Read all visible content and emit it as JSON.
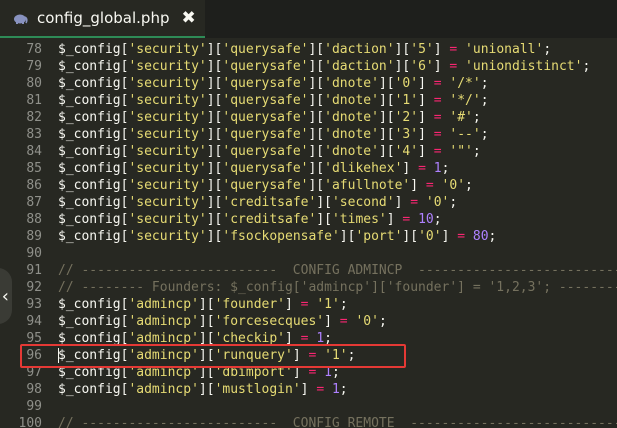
{
  "tab": {
    "title": "config_global.php",
    "close_glyph": "✖",
    "icon": "php-elephant-icon"
  },
  "side_button": {
    "glyph": "‹"
  },
  "colors": {
    "background": "#272822",
    "string": "#e6db74",
    "operator": "#f92672",
    "number": "#ae81ff",
    "comment": "#75715e",
    "line_number": "#8f908a",
    "highlight_box": "#e53935"
  },
  "highlighted_line": 96,
  "lines": [
    {
      "num": "78",
      "tokens": [
        [
          "v",
          "$_config"
        ],
        [
          "p",
          "["
        ],
        [
          "s",
          "'security'"
        ],
        [
          "p",
          "]["
        ],
        [
          "s",
          "'querysafe'"
        ],
        [
          "p",
          "]["
        ],
        [
          "s",
          "'daction'"
        ],
        [
          "p",
          "]["
        ],
        [
          "s",
          "'5'"
        ],
        [
          "p",
          "] "
        ],
        [
          "o",
          "="
        ],
        [
          "p",
          " "
        ],
        [
          "s",
          "'unionall'"
        ],
        [
          "p",
          ";"
        ]
      ]
    },
    {
      "num": "79",
      "tokens": [
        [
          "v",
          "$_config"
        ],
        [
          "p",
          "["
        ],
        [
          "s",
          "'security'"
        ],
        [
          "p",
          "]["
        ],
        [
          "s",
          "'querysafe'"
        ],
        [
          "p",
          "]["
        ],
        [
          "s",
          "'daction'"
        ],
        [
          "p",
          "]["
        ],
        [
          "s",
          "'6'"
        ],
        [
          "p",
          "] "
        ],
        [
          "o",
          "="
        ],
        [
          "p",
          " "
        ],
        [
          "s",
          "'uniondistinct'"
        ],
        [
          "p",
          ";"
        ]
      ]
    },
    {
      "num": "80",
      "tokens": [
        [
          "v",
          "$_config"
        ],
        [
          "p",
          "["
        ],
        [
          "s",
          "'security'"
        ],
        [
          "p",
          "]["
        ],
        [
          "s",
          "'querysafe'"
        ],
        [
          "p",
          "]["
        ],
        [
          "s",
          "'dnote'"
        ],
        [
          "p",
          "]["
        ],
        [
          "s",
          "'0'"
        ],
        [
          "p",
          "] "
        ],
        [
          "o",
          "="
        ],
        [
          "p",
          " "
        ],
        [
          "s",
          "'/*'"
        ],
        [
          "p",
          ";"
        ]
      ]
    },
    {
      "num": "81",
      "tokens": [
        [
          "v",
          "$_config"
        ],
        [
          "p",
          "["
        ],
        [
          "s",
          "'security'"
        ],
        [
          "p",
          "]["
        ],
        [
          "s",
          "'querysafe'"
        ],
        [
          "p",
          "]["
        ],
        [
          "s",
          "'dnote'"
        ],
        [
          "p",
          "]["
        ],
        [
          "s",
          "'1'"
        ],
        [
          "p",
          "] "
        ],
        [
          "o",
          "="
        ],
        [
          "p",
          " "
        ],
        [
          "s",
          "'*/'"
        ],
        [
          "p",
          ";"
        ]
      ]
    },
    {
      "num": "82",
      "tokens": [
        [
          "v",
          "$_config"
        ],
        [
          "p",
          "["
        ],
        [
          "s",
          "'security'"
        ],
        [
          "p",
          "]["
        ],
        [
          "s",
          "'querysafe'"
        ],
        [
          "p",
          "]["
        ],
        [
          "s",
          "'dnote'"
        ],
        [
          "p",
          "]["
        ],
        [
          "s",
          "'2'"
        ],
        [
          "p",
          "] "
        ],
        [
          "o",
          "="
        ],
        [
          "p",
          " "
        ],
        [
          "s",
          "'#'"
        ],
        [
          "p",
          ";"
        ]
      ]
    },
    {
      "num": "83",
      "tokens": [
        [
          "v",
          "$_config"
        ],
        [
          "p",
          "["
        ],
        [
          "s",
          "'security'"
        ],
        [
          "p",
          "]["
        ],
        [
          "s",
          "'querysafe'"
        ],
        [
          "p",
          "]["
        ],
        [
          "s",
          "'dnote'"
        ],
        [
          "p",
          "]["
        ],
        [
          "s",
          "'3'"
        ],
        [
          "p",
          "] "
        ],
        [
          "o",
          "="
        ],
        [
          "p",
          " "
        ],
        [
          "s",
          "'--'"
        ],
        [
          "p",
          ";"
        ]
      ]
    },
    {
      "num": "84",
      "tokens": [
        [
          "v",
          "$_config"
        ],
        [
          "p",
          "["
        ],
        [
          "s",
          "'security'"
        ],
        [
          "p",
          "]["
        ],
        [
          "s",
          "'querysafe'"
        ],
        [
          "p",
          "]["
        ],
        [
          "s",
          "'dnote'"
        ],
        [
          "p",
          "]["
        ],
        [
          "s",
          "'4'"
        ],
        [
          "p",
          "] "
        ],
        [
          "o",
          "="
        ],
        [
          "p",
          " "
        ],
        [
          "s",
          "'\"'"
        ],
        [
          "p",
          ";"
        ]
      ]
    },
    {
      "num": "85",
      "tokens": [
        [
          "v",
          "$_config"
        ],
        [
          "p",
          "["
        ],
        [
          "s",
          "'security'"
        ],
        [
          "p",
          "]["
        ],
        [
          "s",
          "'querysafe'"
        ],
        [
          "p",
          "]["
        ],
        [
          "s",
          "'dlikehex'"
        ],
        [
          "p",
          "] "
        ],
        [
          "o",
          "="
        ],
        [
          "p",
          " "
        ],
        [
          "n",
          "1"
        ],
        [
          "p",
          ";"
        ]
      ]
    },
    {
      "num": "86",
      "tokens": [
        [
          "v",
          "$_config"
        ],
        [
          "p",
          "["
        ],
        [
          "s",
          "'security'"
        ],
        [
          "p",
          "]["
        ],
        [
          "s",
          "'querysafe'"
        ],
        [
          "p",
          "]["
        ],
        [
          "s",
          "'afullnote'"
        ],
        [
          "p",
          "] "
        ],
        [
          "o",
          "="
        ],
        [
          "p",
          " "
        ],
        [
          "s",
          "'0'"
        ],
        [
          "p",
          ";"
        ]
      ]
    },
    {
      "num": "87",
      "tokens": [
        [
          "v",
          "$_config"
        ],
        [
          "p",
          "["
        ],
        [
          "s",
          "'security'"
        ],
        [
          "p",
          "]["
        ],
        [
          "s",
          "'creditsafe'"
        ],
        [
          "p",
          "]["
        ],
        [
          "s",
          "'second'"
        ],
        [
          "p",
          "] "
        ],
        [
          "o",
          "="
        ],
        [
          "p",
          " "
        ],
        [
          "s",
          "'0'"
        ],
        [
          "p",
          ";"
        ]
      ]
    },
    {
      "num": "88",
      "tokens": [
        [
          "v",
          "$_config"
        ],
        [
          "p",
          "["
        ],
        [
          "s",
          "'security'"
        ],
        [
          "p",
          "]["
        ],
        [
          "s",
          "'creditsafe'"
        ],
        [
          "p",
          "]["
        ],
        [
          "s",
          "'times'"
        ],
        [
          "p",
          "] "
        ],
        [
          "o",
          "="
        ],
        [
          "p",
          " "
        ],
        [
          "n",
          "10"
        ],
        [
          "p",
          ";"
        ]
      ]
    },
    {
      "num": "89",
      "tokens": [
        [
          "v",
          "$_config"
        ],
        [
          "p",
          "["
        ],
        [
          "s",
          "'security'"
        ],
        [
          "p",
          "]["
        ],
        [
          "s",
          "'fsockopensafe'"
        ],
        [
          "p",
          "]["
        ],
        [
          "s",
          "'port'"
        ],
        [
          "p",
          "]["
        ],
        [
          "s",
          "'0'"
        ],
        [
          "p",
          "] "
        ],
        [
          "o",
          "="
        ],
        [
          "p",
          " "
        ],
        [
          "n",
          "80"
        ],
        [
          "p",
          ";"
        ]
      ]
    },
    {
      "num": "90",
      "tokens": []
    },
    {
      "num": "91",
      "tokens": [
        [
          "c",
          "// -------------------------  CONFIG ADMINCP  -----------------------------"
        ]
      ]
    },
    {
      "num": "92",
      "tokens": [
        [
          "c",
          "// -------- Founders: $_config['admincp']['founder'] = '1,2,3'; ------------"
        ]
      ]
    },
    {
      "num": "93",
      "tokens": [
        [
          "v",
          "$_config"
        ],
        [
          "p",
          "["
        ],
        [
          "s",
          "'admincp'"
        ],
        [
          "p",
          "]["
        ],
        [
          "s",
          "'founder'"
        ],
        [
          "p",
          "] "
        ],
        [
          "o",
          "="
        ],
        [
          "p",
          " "
        ],
        [
          "s",
          "'1'"
        ],
        [
          "p",
          ";"
        ]
      ]
    },
    {
      "num": "94",
      "tokens": [
        [
          "v",
          "$_config"
        ],
        [
          "p",
          "["
        ],
        [
          "s",
          "'admincp'"
        ],
        [
          "p",
          "]["
        ],
        [
          "s",
          "'forcesecques'"
        ],
        [
          "p",
          "] "
        ],
        [
          "o",
          "="
        ],
        [
          "p",
          " "
        ],
        [
          "s",
          "'0'"
        ],
        [
          "p",
          ";"
        ]
      ]
    },
    {
      "num": "95",
      "tokens": [
        [
          "v",
          "$_config"
        ],
        [
          "p",
          "["
        ],
        [
          "s",
          "'admincp'"
        ],
        [
          "p",
          "]["
        ],
        [
          "s",
          "'checkip'"
        ],
        [
          "p",
          "] "
        ],
        [
          "o",
          "="
        ],
        [
          "p",
          " "
        ],
        [
          "n",
          "1"
        ],
        [
          "p",
          ";"
        ]
      ]
    },
    {
      "num": "96",
      "tokens": [
        [
          "v",
          "$_config"
        ],
        [
          "p",
          "["
        ],
        [
          "s",
          "'admincp'"
        ],
        [
          "p",
          "]["
        ],
        [
          "s",
          "'runquery'"
        ],
        [
          "p",
          "] "
        ],
        [
          "o",
          "="
        ],
        [
          "p",
          " "
        ],
        [
          "s",
          "'1'"
        ],
        [
          "p",
          ";"
        ]
      ]
    },
    {
      "num": "97",
      "tokens": [
        [
          "v",
          "$_config"
        ],
        [
          "p",
          "["
        ],
        [
          "s",
          "'admincp'"
        ],
        [
          "p",
          "]["
        ],
        [
          "s",
          "'dbimport'"
        ],
        [
          "p",
          "] "
        ],
        [
          "o",
          "="
        ],
        [
          "p",
          " "
        ],
        [
          "n",
          "1"
        ],
        [
          "p",
          ";"
        ]
      ]
    },
    {
      "num": "98",
      "tokens": [
        [
          "v",
          "$_config"
        ],
        [
          "p",
          "["
        ],
        [
          "s",
          "'admincp'"
        ],
        [
          "p",
          "]["
        ],
        [
          "s",
          "'mustlogin'"
        ],
        [
          "p",
          "] "
        ],
        [
          "o",
          "="
        ],
        [
          "p",
          " "
        ],
        [
          "n",
          "1"
        ],
        [
          "p",
          ";"
        ]
      ]
    },
    {
      "num": "99",
      "tokens": []
    },
    {
      "num": "100",
      "tokens": [
        [
          "c",
          "// -------------------------  CONFIG REMOTE  ------------------------------"
        ]
      ]
    }
  ]
}
